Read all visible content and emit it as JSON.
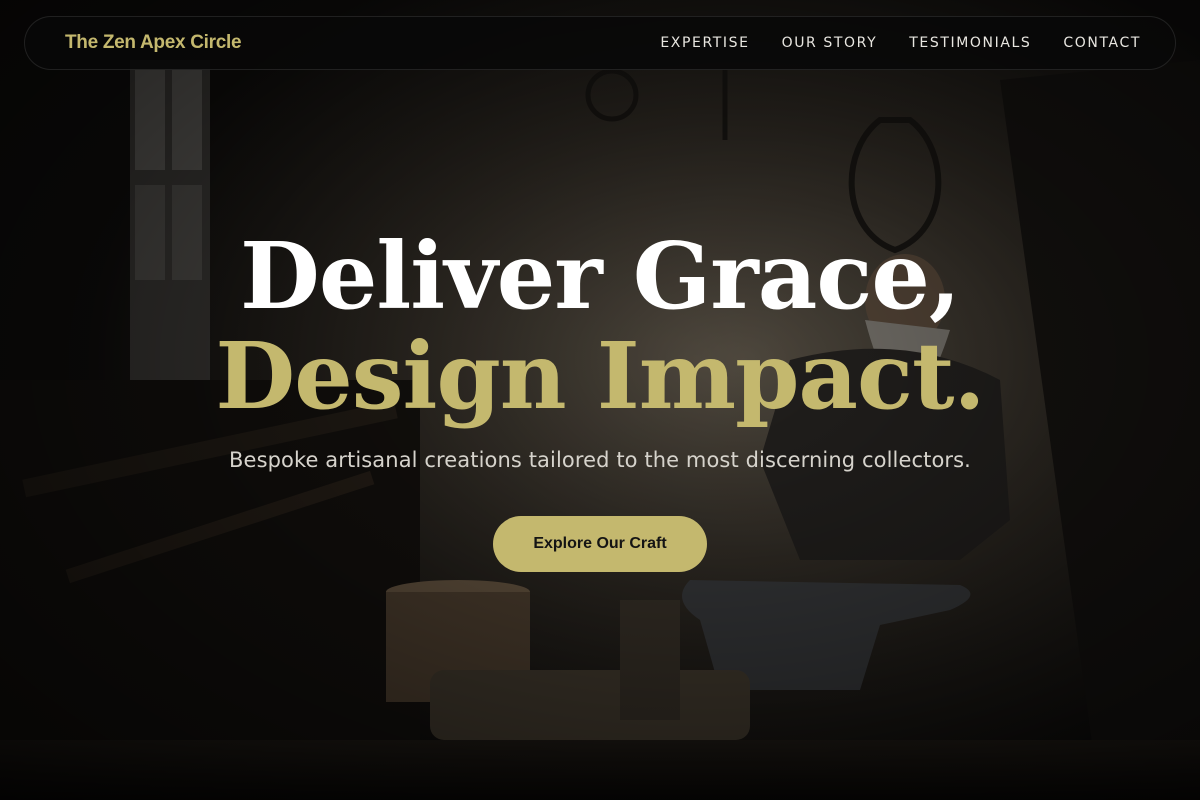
{
  "brand": {
    "name": "The Zen Apex Circle",
    "accent": "#c4b86e"
  },
  "nav": {
    "items": [
      {
        "label": "EXPERTISE"
      },
      {
        "label": "OUR STORY"
      },
      {
        "label": "TESTIMONIALS"
      },
      {
        "label": "CONTACT"
      }
    ]
  },
  "hero": {
    "headline_line1": "Deliver Grace,",
    "headline_line2": "Design Impact.",
    "subtitle": "Bespoke artisanal creations tailored to the most discerning collectors.",
    "cta_label": "Explore Our Craft",
    "background_image": "blacksmith-workshop-photo"
  }
}
